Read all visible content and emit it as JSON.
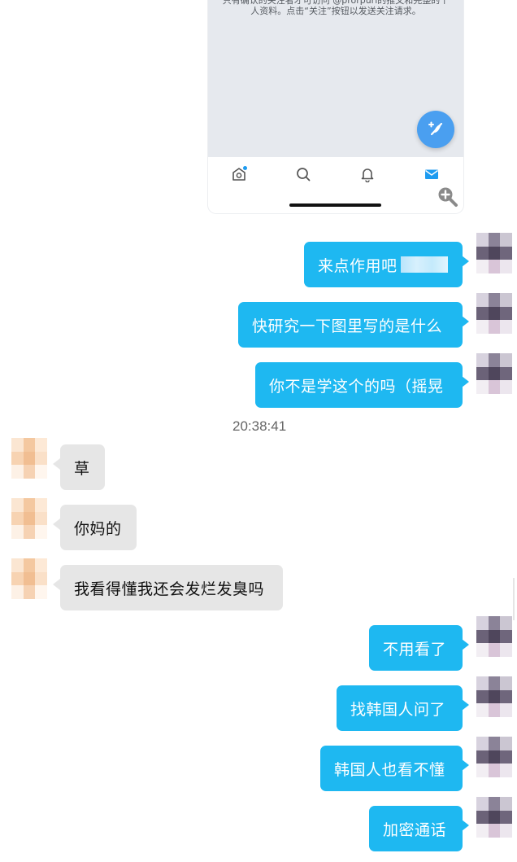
{
  "screenshot": {
    "text": "只有确认的关注者才可访问 @prorpurl的推文和完整的个人资料。点击“关注”按钮以发送关注请求。",
    "tabs": [
      "home-icon",
      "search-icon",
      "bell-icon",
      "mail-icon"
    ],
    "fab_icon": "compose-tweet-icon",
    "zoom_icon": "zoom-in-icon",
    "accent": "#1d9bf0"
  },
  "messages": {
    "m1": "来点作用吧",
    "m2": "快研究一下图里写的是什么",
    "m3": "你不是学这个的吗（摇晃",
    "timestamp": "20:38:41",
    "m4": "草",
    "m5": "你妈的",
    "m6": "我看得懂我还会发烂发臭吗",
    "m7": "不用看了",
    "m8": "找韩国人问了",
    "m9": "韩国人也看不懂",
    "m10": "加密通话"
  },
  "colors": {
    "outgoing_bubble": "#1eb8f1",
    "incoming_bubble": "#e6e6e6"
  }
}
